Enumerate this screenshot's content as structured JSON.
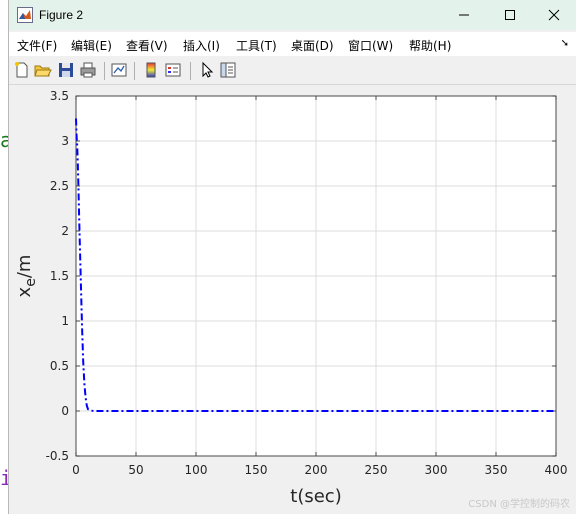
{
  "window": {
    "title": "Figure 2"
  },
  "background_glyphs": [
    "a",
    "i"
  ],
  "menu": {
    "items": [
      "文件(F)",
      "编辑(E)",
      "查看(V)",
      "插入(I)",
      "工具(T)",
      "桌面(D)",
      "窗口(W)",
      "帮助(H)"
    ]
  },
  "toolbar": {
    "icons": [
      "new-figure-icon",
      "open-file-icon",
      "save-icon",
      "print-icon",
      "link-plot-icon",
      "insert-colorbar-icon",
      "insert-legend-icon",
      "pointer-icon",
      "property-editor-icon"
    ]
  },
  "chart_data": {
    "type": "line",
    "xlabel": "t(sec)",
    "ylabel_main": "x",
    "ylabel_sub": "e",
    "ylabel_suffix": "/m",
    "xlim": [
      0,
      400
    ],
    "ylim": [
      -0.5,
      3.5
    ],
    "xticks": [
      "0",
      "50",
      "100",
      "150",
      "200",
      "250",
      "300",
      "350",
      "400"
    ],
    "yticks": [
      "-0.5",
      "0",
      "0.5",
      "1",
      "1.5",
      "2",
      "2.5",
      "3",
      "3.5"
    ],
    "grid": true,
    "line_style": "dash-dot",
    "color": "#0000ff",
    "series": [
      {
        "x": [
          0,
          0.5,
          1,
          1.5,
          2,
          3,
          4,
          5,
          6,
          7,
          8,
          9,
          10,
          12,
          15,
          20,
          30,
          50,
          100,
          200,
          300,
          400
        ],
        "y": [
          3.25,
          3.05,
          2.95,
          2.75,
          2.5,
          1.95,
          1.45,
          0.95,
          0.55,
          0.3,
          0.15,
          0.06,
          0.02,
          0.005,
          0.0,
          0.0,
          0.0,
          0.0,
          0.0,
          0.0,
          0.0,
          0.0
        ]
      }
    ]
  },
  "watermark": "CSDN @学控制的码农",
  "colors": {
    "titlebar": "#e3f2ea",
    "line": "#0000ff",
    "grid": "#dcdcdc"
  }
}
